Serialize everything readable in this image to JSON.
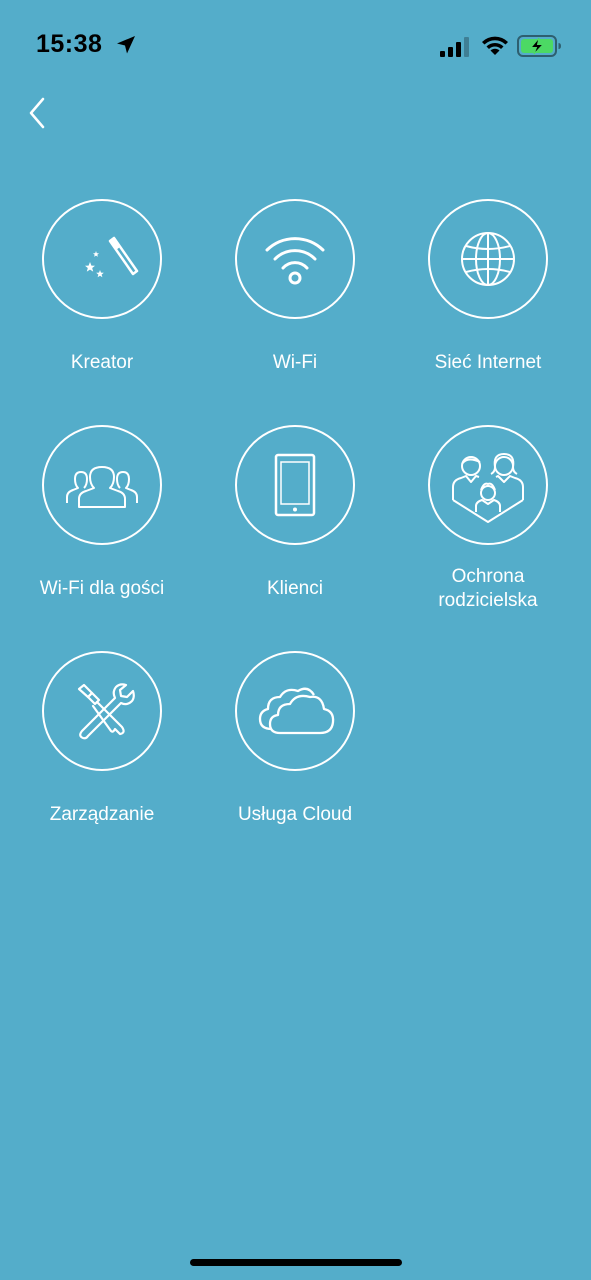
{
  "status_bar": {
    "time": "15:38",
    "icons": [
      "location-arrow-icon",
      "cellular-signal-icon",
      "wifi-icon",
      "battery-charging-icon"
    ]
  },
  "nav": {
    "back_icon": "chevron-left-icon"
  },
  "menu": {
    "items": [
      {
        "label": "Kreator",
        "icon": "magic-wand-icon"
      },
      {
        "label": "Wi-Fi",
        "icon": "wifi-icon"
      },
      {
        "label": "Sieć Internet",
        "icon": "globe-icon"
      },
      {
        "label": "Wi-Fi dla gości",
        "icon": "guests-group-icon"
      },
      {
        "label": "Klienci",
        "icon": "tablet-icon"
      },
      {
        "label_line1": "Ochrona",
        "label_line2": "rodzicielska",
        "icon": "family-icon"
      },
      {
        "label": "Zarządzanie",
        "icon": "tools-icon"
      },
      {
        "label": "Usługa Cloud",
        "icon": "cloud-icon"
      }
    ]
  },
  "colors": {
    "background": "#54adca",
    "foreground": "#ffffff",
    "battery_fill": "#4cd964"
  }
}
